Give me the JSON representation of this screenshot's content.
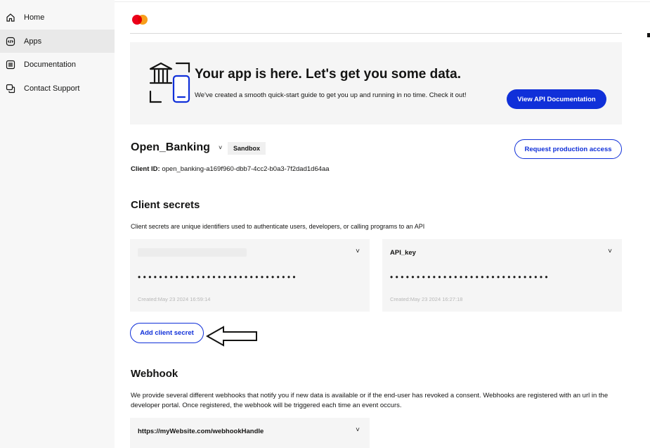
{
  "sidebar": {
    "items": [
      {
        "label": "Home",
        "icon": "home-icon"
      },
      {
        "label": "Apps",
        "icon": "apps-icon",
        "active": true
      },
      {
        "label": "Documentation",
        "icon": "documentation-icon"
      },
      {
        "label": "Contact Support",
        "icon": "contact-support-icon"
      }
    ]
  },
  "brand": {
    "logo": "mastercard-logo",
    "colors": {
      "red": "#eb001b",
      "orange": "#f79e1b"
    }
  },
  "banner": {
    "title": "Your app is here. Let's get you some data.",
    "subtitle": "We've created a smooth quick-start guide to get you up and running in no time. Check it out!",
    "button": "View API Documentation",
    "illustration": "bank-and-phone-icon"
  },
  "app": {
    "name": "Open_Banking",
    "caret": "˅",
    "environment_badge": "Sandbox",
    "client_id_label": "Client ID:",
    "client_id_value": "open_banking-a169f960-dbb7-4cc2-b0a3-7f2dad1d64aa",
    "request_button": "Request production access"
  },
  "client_secrets": {
    "title": "Client secrets",
    "description": "Client secrets are unique identifiers used to authenticate users, developers, or calling programs to an API",
    "secrets": [
      {
        "name": "",
        "masked": "••••••••••••••••••••••••••••••",
        "created": "Created:May 23 2024 16:59:14"
      },
      {
        "name": "API_key",
        "masked": "••••••••••••••••••••••••••••••",
        "created": "Created:May 23 2024 16:27:18"
      }
    ],
    "add_button": "Add client secret"
  },
  "webhook": {
    "title": "Webhook",
    "description": "We provide several different webhooks that notify you if new data is available or if the end-user has revoked a consent. Webhooks are registered with an url in the developer portal. Once registered, the webhook will be triggered each time an event occurs.",
    "url": "https://myWebsite.com/webhookHandle"
  },
  "colors": {
    "accent": "#1030d9",
    "card_bg": "#f5f5f5",
    "sidebar_bg": "#f7f7f7"
  }
}
